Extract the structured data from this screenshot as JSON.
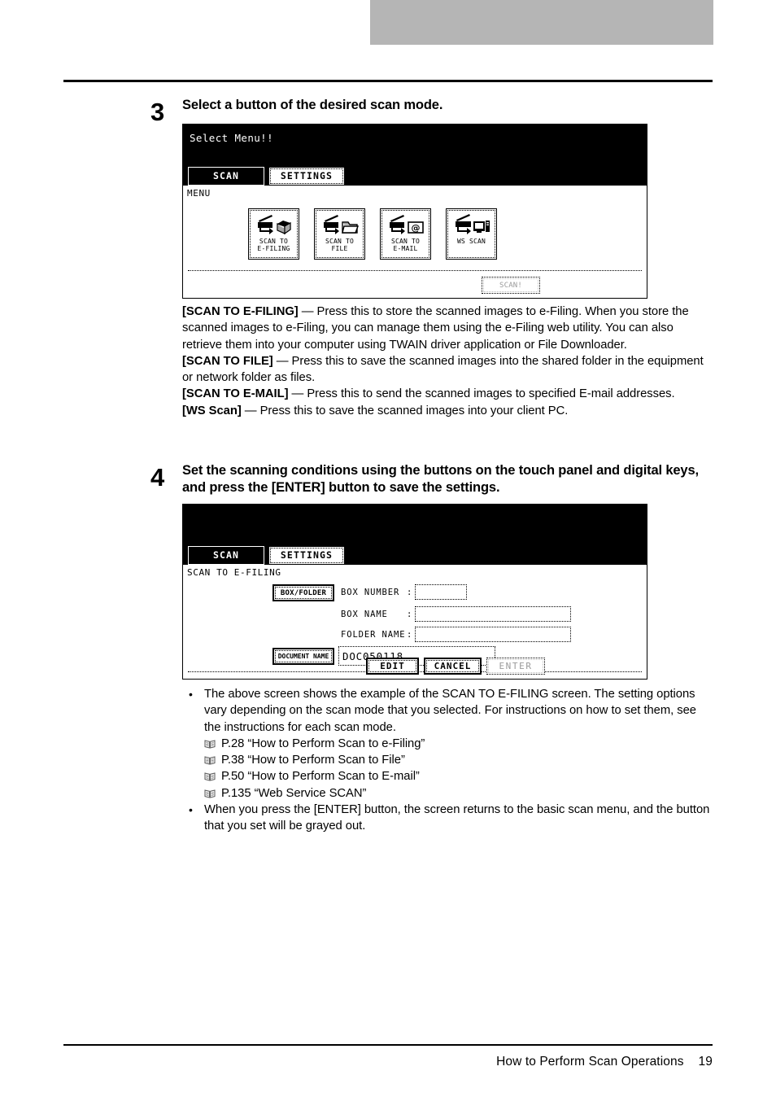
{
  "page": {
    "footer_title": "How to Perform Scan Operations",
    "footer_page_number": "19"
  },
  "steps": [
    {
      "number": "3",
      "title": "Select a button of the desired scan mode."
    },
    {
      "number": "4",
      "title": "Set the scanning conditions using the buttons on the touch panel and digital keys, and press the [ENTER] button to save the settings."
    }
  ],
  "panel_menu": {
    "message": "Select Menu!!",
    "tabs": [
      {
        "label": "SCAN",
        "state": "active"
      },
      {
        "label": "SETTINGS",
        "state": "inactive"
      }
    ],
    "breadcrumb": "MENU",
    "modes": [
      {
        "caption": "SCAN TO\nE-FILING",
        "icon": "scan-to-efiling-icon"
      },
      {
        "caption": "SCAN TO\nFILE",
        "icon": "scan-to-file-icon"
      },
      {
        "caption": "SCAN TO\nE-MAIL",
        "icon": "scan-to-email-icon"
      },
      {
        "caption": "WS SCAN",
        "icon": "ws-scan-icon"
      }
    ],
    "action_button": {
      "label": "SCAN!",
      "state": "disabled"
    }
  },
  "panel_efiling": {
    "tabs": [
      {
        "label": "SCAN",
        "state": "active"
      },
      {
        "label": "SETTINGS",
        "state": "inactive"
      }
    ],
    "breadcrumb": "SCAN TO E-FILING",
    "box_folder_button": "BOX/FOLDER",
    "document_name_button": "DOCUMENT NAME",
    "fields": [
      {
        "label": "BOX NUMBER",
        "value": ""
      },
      {
        "label": "BOX NAME",
        "value": ""
      },
      {
        "label": "FOLDER NAME",
        "value": ""
      }
    ],
    "document_name_value": "DOC050118",
    "buttons": [
      {
        "label": "EDIT",
        "state": "enabled"
      },
      {
        "label": "CANCEL",
        "state": "enabled"
      },
      {
        "label": "ENTER",
        "state": "disabled"
      }
    ]
  },
  "descriptions": [
    {
      "term": "[SCAN TO E-FILING]",
      "text": " — Press this to store the scanned images to e-Filing.  When you store the scanned images to e-Filing, you can manage them using the e-Filing web utility. You can also retrieve them into your computer using TWAIN driver application or File Downloader."
    },
    {
      "term": "[SCAN TO FILE]",
      "text": " — Press this to save the scanned images into the shared folder in the equipment or network folder as files."
    },
    {
      "term": "[SCAN TO E-MAIL]",
      "text": " — Press this to send the scanned images to specified E-mail addresses."
    },
    {
      "term": "[WS Scan]",
      "text": " — Press this to save the scanned images into your client PC."
    }
  ],
  "notes": {
    "bullet1": "The above screen shows the example of the SCAN TO E-FILING screen.  The setting options vary depending on the scan mode that you selected.  For instructions on how to set them, see the instructions for each scan mode.",
    "references": [
      "P.28 “How to Perform Scan to e-Filing”",
      "P.38 “How to Perform Scan to File”",
      "P.50 “How to Perform Scan to E-mail”",
      "P.135 “Web Service SCAN”"
    ],
    "bullet2": "When you press the [ENTER] button, the screen returns to the basic scan menu, and the button that you set will be grayed out."
  },
  "colors": {
    "header_bar": "#b5b5b5",
    "lcd_header": "#000000",
    "disabled_text": "#9a9a9a"
  }
}
